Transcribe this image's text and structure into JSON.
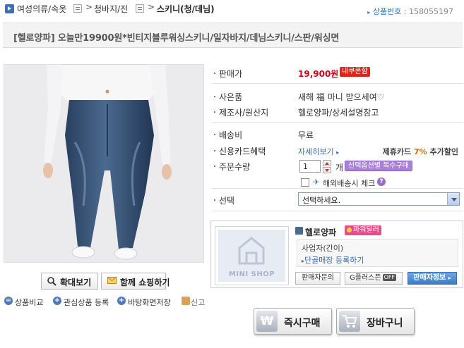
{
  "breadcrumb": {
    "items": [
      "여성의류/속옷",
      "청바지/진",
      "스키니(청/데님)"
    ],
    "separator": ">",
    "product_no_label": "상품번호 :",
    "product_no": "158055197"
  },
  "product": {
    "title": "[헬로양파] 오늘만19900원*빈티지블루워싱스키니/일자바지/데님스키니/스판/워싱면"
  },
  "image_buttons": {
    "zoom": "확대보기",
    "shop_together": "함께 쇼핑하기"
  },
  "utility_links": {
    "compare": "상품비교",
    "wish": "관심상품 등록",
    "desktop": "바탕화면저장",
    "report": "신고"
  },
  "info": {
    "price_label": "판매가",
    "price": "19,900원",
    "coupon_badge": "내쿠폰함",
    "gift_label": "사은품",
    "gift_value": "새해 福 마니 받으세여♡",
    "maker_label": "제조사/원산지",
    "maker_value": "헬로양파/상세설명참고",
    "shipping_label": "배송비",
    "shipping_value": "무료",
    "card_label": "신용카드혜택",
    "card_more": "자세히보기",
    "partner_pre": "제휴카드",
    "partner_pct": "7%",
    "partner_post": "추가할인",
    "qty_label": "주문수량",
    "qty_value": "1",
    "qty_unit": "개",
    "option_bulk_button": "선택옵션별 복수구매",
    "overseas_check": "해외배송시 체크",
    "select_label": "선택",
    "select_value": "선택하세요."
  },
  "seller": {
    "mini_shop": "MINI SHOP",
    "name": "헬로양파",
    "power_badge": "파워딜러",
    "biz_type": "사업자(간이)",
    "danggol": "단골매장 등록하기",
    "ask_button": "판매자문의",
    "gplus_button": "G플러스픈",
    "off_tag": "OFF",
    "seller_info_button": "판매자정보"
  },
  "buy": {
    "buy_now": "즉시구매",
    "cart": "장바구니"
  },
  "colors": {
    "price_red": "#d0021b",
    "link_blue": "#3a6bb0",
    "accent_purple": "#a880d8",
    "partner_orange": "#e06a00"
  }
}
